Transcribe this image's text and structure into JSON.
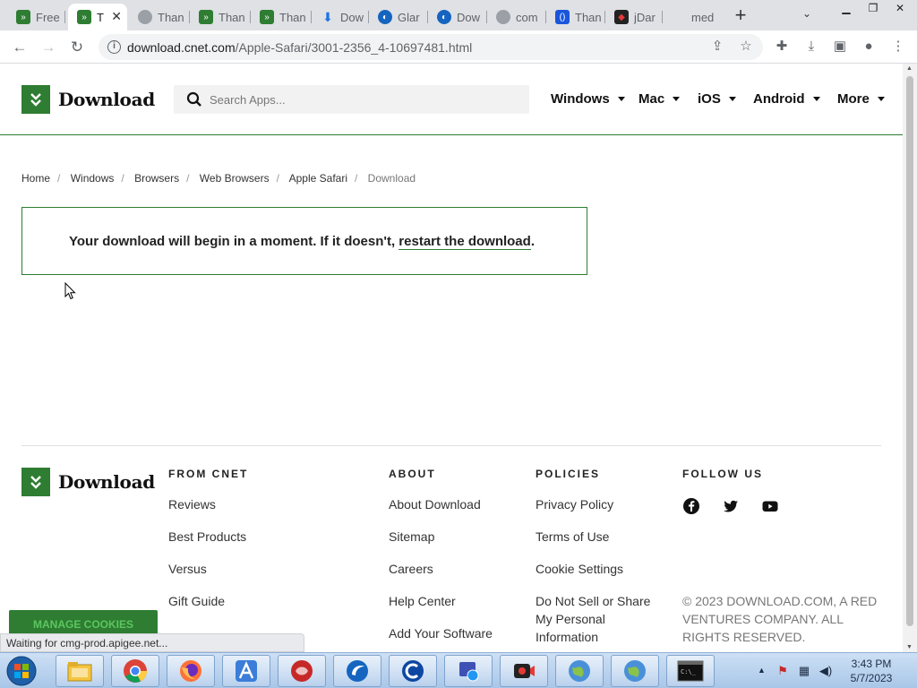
{
  "browser": {
    "tabs": [
      {
        "title": "Free",
        "favicon": "download-logo-icon",
        "active": false
      },
      {
        "title": "T",
        "favicon": "download-logo-icon",
        "active": true
      },
      {
        "title": "Than",
        "favicon": "globe-icon",
        "active": false
      },
      {
        "title": "Than",
        "favicon": "download-logo-icon",
        "active": false
      },
      {
        "title": "Than",
        "favicon": "download-logo-icon",
        "active": false
      },
      {
        "title": "Dow",
        "favicon": "download-arrow-icon",
        "active": false
      },
      {
        "title": "Glar",
        "favicon": "glary-icon",
        "active": false
      },
      {
        "title": "Dow",
        "favicon": "glary-icon",
        "active": false
      },
      {
        "title": "com",
        "favicon": "globe-icon",
        "active": false
      },
      {
        "title": "Than",
        "favicon": "blue-brackets-icon",
        "active": false
      },
      {
        "title": "jDar",
        "favicon": "red-app-icon",
        "active": false
      },
      {
        "title": "med",
        "favicon": "blank-icon",
        "active": false
      }
    ],
    "url_host": "download.cnet.com",
    "url_path": "/Apple-Safari/3001-2356_4-10697481.html"
  },
  "site": {
    "logo_text": "Download",
    "search_placeholder": "Search Apps...",
    "nav": [
      "Windows",
      "Mac",
      "iOS",
      "Android",
      "More"
    ]
  },
  "breadcrumb": [
    "Home",
    "Windows",
    "Browsers",
    "Web Browsers",
    "Apple Safari"
  ],
  "breadcrumb_current": "Download",
  "notice": {
    "text": "Your download will begin in a moment. If it doesn't, ",
    "link": "restart the download",
    "suffix": "."
  },
  "footer": {
    "logo_text": "Download",
    "from_cnet": {
      "heading": "FROM CNET",
      "links": [
        "Reviews",
        "Best Products",
        "Versus",
        "Gift Guide"
      ]
    },
    "about": {
      "heading": "ABOUT",
      "links": [
        "About Download",
        "Sitemap",
        "Careers",
        "Help Center",
        "Add Your Software"
      ]
    },
    "policies": {
      "heading": "POLICIES",
      "links": [
        "Privacy Policy",
        "Terms of Use",
        "Cookie Settings",
        "Do Not Sell or Share My Personal Information"
      ]
    },
    "follow": {
      "heading": "FOLLOW US",
      "icons": [
        "facebook-icon",
        "twitter-icon",
        "youtube-icon"
      ]
    },
    "copyright": "© 2023 DOWNLOAD.COM, A RED VENTURES COMPANY. ALL RIGHTS RESERVED."
  },
  "cookies_button": "MANAGE COOKIES",
  "status_text": "Waiting for cmg-prod.apigee.net...",
  "taskbar": {
    "apps": [
      "file-explorer-icon",
      "chrome-icon",
      "firefox-icon",
      "arc-browser-icon",
      "app-icon",
      "glary-icon",
      "ccleaner-icon",
      "screen-tool-icon",
      "recorder-icon",
      "globe-browser-icon",
      "globe-browser-icon",
      "command-prompt-icon"
    ],
    "time": "3:43 PM",
    "date": "5/7/2023"
  },
  "colors": {
    "brand_green": "#2e7d32",
    "tab_strip": "#dfe1e5",
    "taskbar": "#b9d1ee"
  }
}
